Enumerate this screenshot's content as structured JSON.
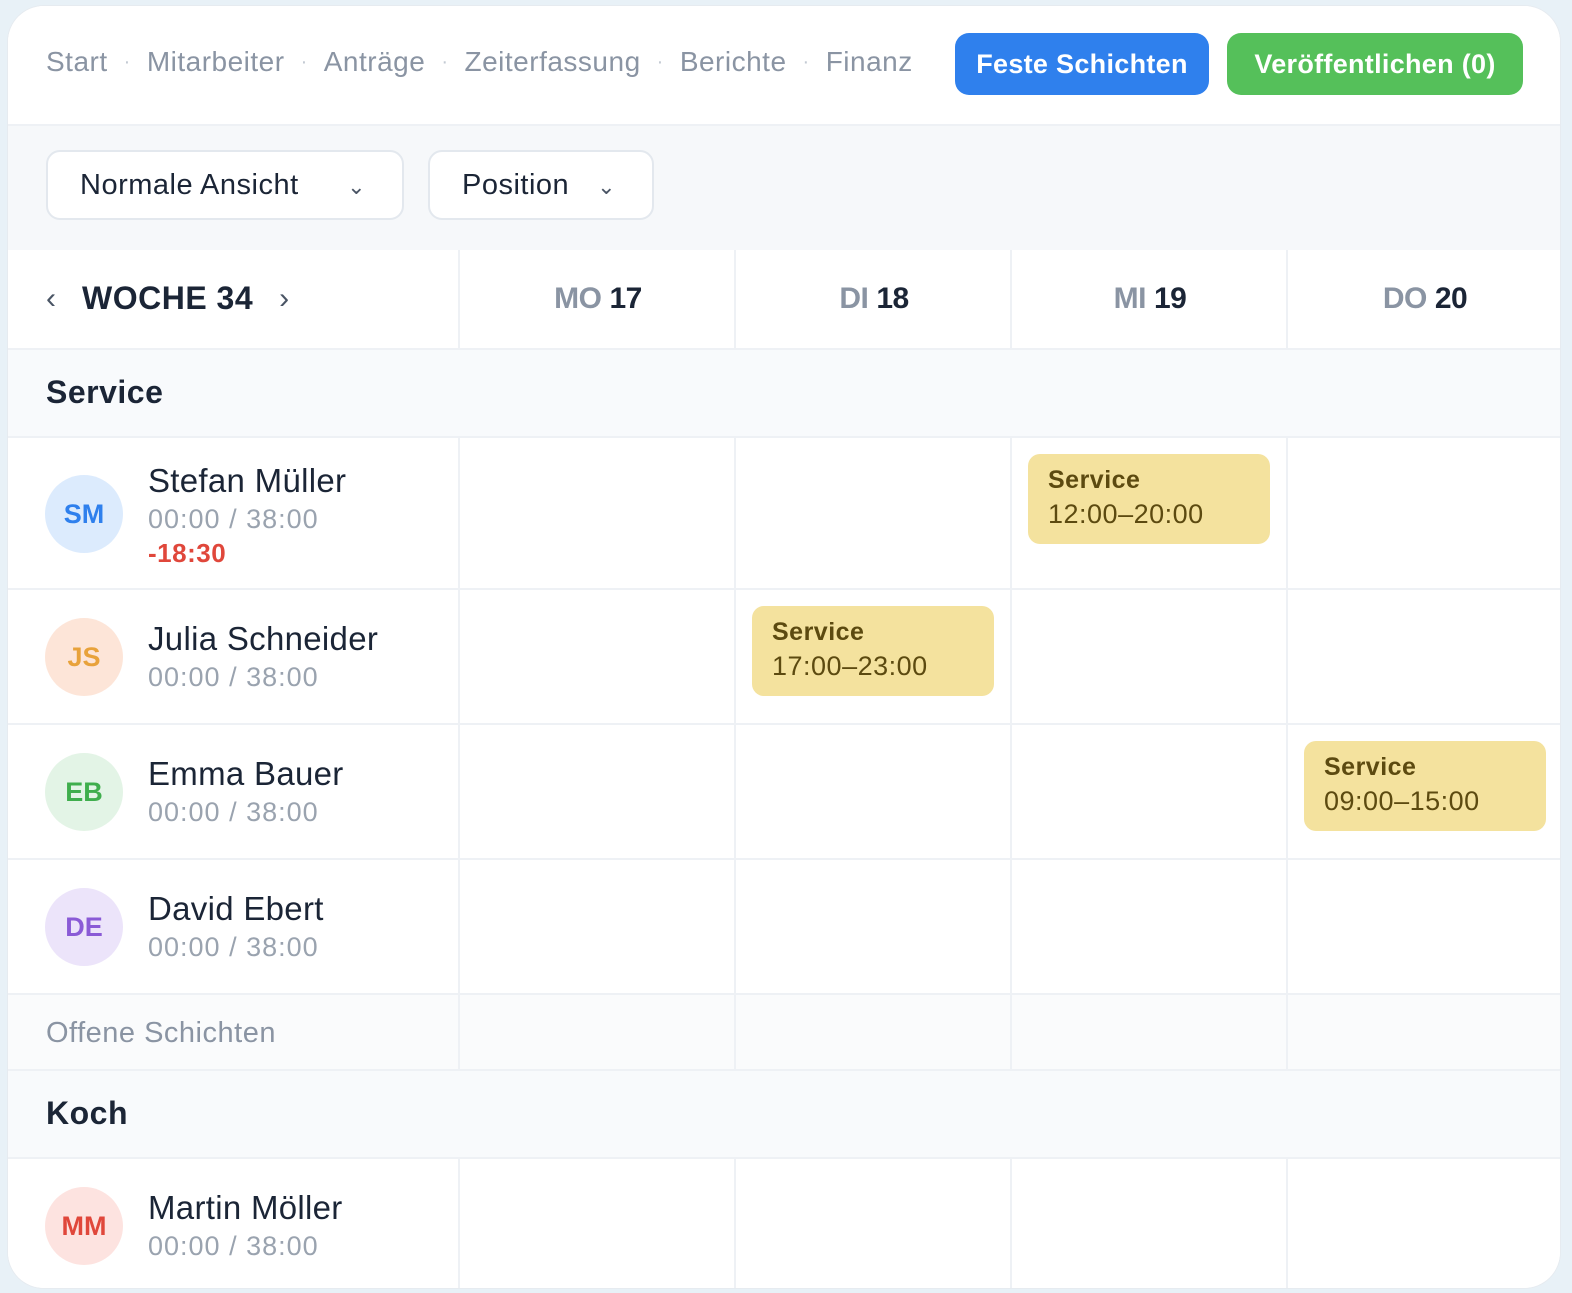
{
  "nav": {
    "items": [
      "Start",
      "Mitarbeiter",
      "Anträge",
      "Zeiterfassung",
      "Berichte",
      "Finanz"
    ],
    "fixed_shifts_button": "Feste Schichten",
    "publish_button": "Veröffentlichen (0)"
  },
  "filters": {
    "view": "Normale Ansicht",
    "group": "Position"
  },
  "week": {
    "label": "WOCHE 34",
    "prev_icon": "chevron-left-icon",
    "next_icon": "chevron-right-icon"
  },
  "days": [
    {
      "dn": "MO",
      "num": "17"
    },
    {
      "dn": "DI",
      "num": "18"
    },
    {
      "dn": "MI",
      "num": "19"
    },
    {
      "dn": "DO",
      "num": "20"
    }
  ],
  "sections": {
    "service": "Service",
    "open_shifts": "Offene Schichten",
    "koch": "Koch"
  },
  "employees": [
    {
      "initials": "SM",
      "name": "Stefan Müller",
      "hours": "00:00 / 38:00",
      "diff": "-18:30",
      "avatar_bg": "#dcebfd",
      "avatar_fg": "#2f80ed"
    },
    {
      "initials": "JS",
      "name": "Julia Schneider",
      "hours": "00:00 / 38:00",
      "avatar_bg": "#fde5d8",
      "avatar_fg": "#e8a23b"
    },
    {
      "initials": "EB",
      "name": "Emma Bauer",
      "hours": "00:00 / 38:00",
      "avatar_bg": "#e3f4e6",
      "avatar_fg": "#3fae4d"
    },
    {
      "initials": "DE",
      "name": "David Ebert",
      "hours": "00:00 / 38:00",
      "avatar_bg": "#ece4fa",
      "avatar_fg": "#8a5ad6"
    },
    {
      "initials": "MM",
      "name": "Martin Möller",
      "hours": "00:00 / 38:00",
      "avatar_bg": "#fde3e0",
      "avatar_fg": "#e0473b"
    }
  ],
  "shifts": [
    {
      "title": "Service",
      "time": "12:00–20:00"
    },
    {
      "title": "Service",
      "time": "17:00–23:00"
    },
    {
      "title": "Service",
      "time": "09:00–15:00"
    }
  ],
  "colors": {
    "blue": "#2f80ed",
    "green": "#55c05a",
    "shift": "#f4e29e",
    "negative": "#e0473b"
  }
}
